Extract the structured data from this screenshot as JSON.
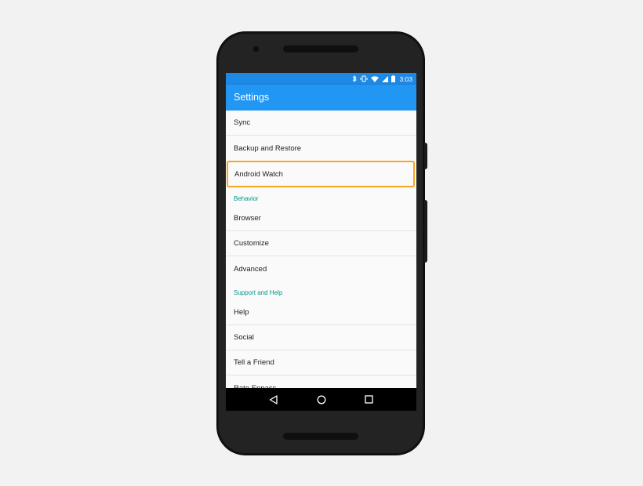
{
  "status_bar": {
    "time": "3:03",
    "icons": [
      "bluetooth-icon",
      "vibrate-icon",
      "wifi-icon",
      "signal-icon",
      "battery-icon"
    ]
  },
  "app_bar": {
    "title": "Settings"
  },
  "settings": {
    "general_items": [
      "Sync",
      "Backup and Restore",
      "Android Watch"
    ],
    "behavior_header": "Behavior",
    "behavior_items": [
      "Browser",
      "Customize",
      "Advanced"
    ],
    "support_header": "Support and Help",
    "support_items": [
      "Help",
      "Social",
      "Tell a Friend",
      "Rate Enpass"
    ]
  },
  "nav_bar": {
    "icons": [
      "back-icon",
      "home-icon",
      "recents-icon"
    ]
  },
  "colors": {
    "status_bar": "#1e88e5",
    "app_bar": "#2196f3",
    "section_header": "#009688",
    "highlight_outline": "#f5a623"
  }
}
